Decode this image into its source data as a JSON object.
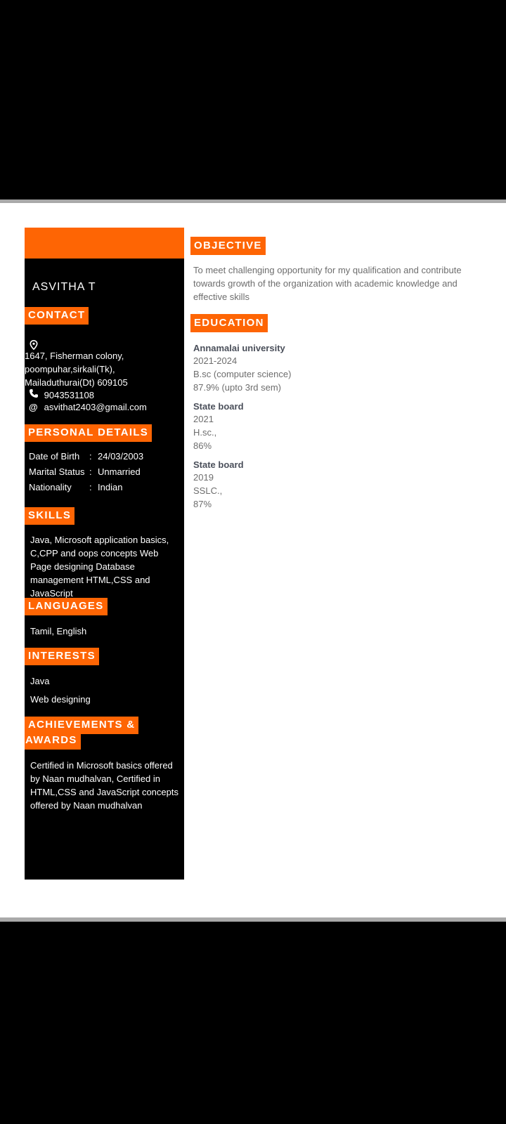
{
  "resume": {
    "name": "ASVITHA T",
    "contact": {
      "heading": "CONTACT",
      "location_icon": "location-pin-icon",
      "address": "1647, Fisherman colony, poompuhar,sirkali(Tk), Mailaduthurai(Dt) 609105",
      "phone_icon": "phone-icon",
      "phone": "9043531108",
      "email_icon": "at-sign-icon",
      "email": "asvithat2403@gmail.com"
    },
    "personal": {
      "heading": "PERSONAL DETAILS",
      "rows": [
        {
          "label": "Date of Birth",
          "sep": ":",
          "value": "24/03/2003"
        },
        {
          "label": "Marital Status",
          "sep": ":",
          "value": "Unmarried"
        },
        {
          "label": "Nationality",
          "sep": ":",
          "value": "Indian"
        }
      ]
    },
    "skills": {
      "heading": "SKILLS",
      "text": "Java, Microsoft application basics, C,CPP and oops concepts Web Page designing Database management HTML,CSS and JavaScript"
    },
    "languages": {
      "heading": "LANGUAGES",
      "text": "Tamil, English"
    },
    "interests": {
      "heading": "INTERESTS",
      "items": [
        "Java",
        "Web designing"
      ]
    },
    "achievements": {
      "heading_line1": "ACHIEVEMENTS &",
      "heading_line2": "AWARDS",
      "text": "Certified in Microsoft basics offered by Naan mudhalvan, Certified in HTML,CSS and JavaScript concepts offered by Naan mudhalvan"
    },
    "objective": {
      "heading": "OBJECTIVE",
      "text": "To meet challenging opportunity for my qualification and contribute towards growth of the organization with academic knowledge and effective skills"
    },
    "education": {
      "heading": "EDUCATION",
      "entries": [
        {
          "institution": "Annamalai university",
          "years": "2021-2024",
          "course": "B.sc (computer science)",
          "score": "87.9% (upto 3rd sem)"
        },
        {
          "institution": "State board",
          "years": "2021",
          "course": "H.sc.,",
          "score": "86%"
        },
        {
          "institution": "State board",
          "years": "2019",
          "course": "SSLC.,",
          "score": "87%"
        }
      ]
    }
  },
  "colors": {
    "accent": "#fe6504",
    "sidebar": "#000000",
    "page": "#ffffff",
    "frame": "#000000"
  }
}
